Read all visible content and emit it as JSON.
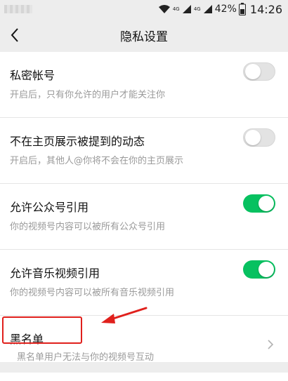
{
  "status_bar": {
    "battery_percent": "42%",
    "time": "14:26",
    "network_1": "4G",
    "network_2": "4G"
  },
  "nav": {
    "title": "隐私设置"
  },
  "settings": [
    {
      "title": "私密帐号",
      "desc": "开启后，只有你允许的用户才能关注你",
      "control": "toggle",
      "enabled": false
    },
    {
      "title": "不在主页展示被提到的动态",
      "desc": "开启后，其他人@你将不会在你的主页展示",
      "control": "toggle",
      "enabled": false
    },
    {
      "title": "允许公众号引用",
      "desc": "你的视频号内容可以被所有公众号引用",
      "control": "toggle",
      "enabled": true
    },
    {
      "title": "允许音乐视频引用",
      "desc": "你的视频号内容可以被所有音乐视频引用",
      "control": "toggle",
      "enabled": true
    },
    {
      "title": "黑名单",
      "desc": "黑名单用户无法与你的视频号互动",
      "control": "chevron"
    }
  ],
  "colors": {
    "accent_green": "#07c160",
    "annotation_red": "#e0201c",
    "background": "#ededed"
  }
}
